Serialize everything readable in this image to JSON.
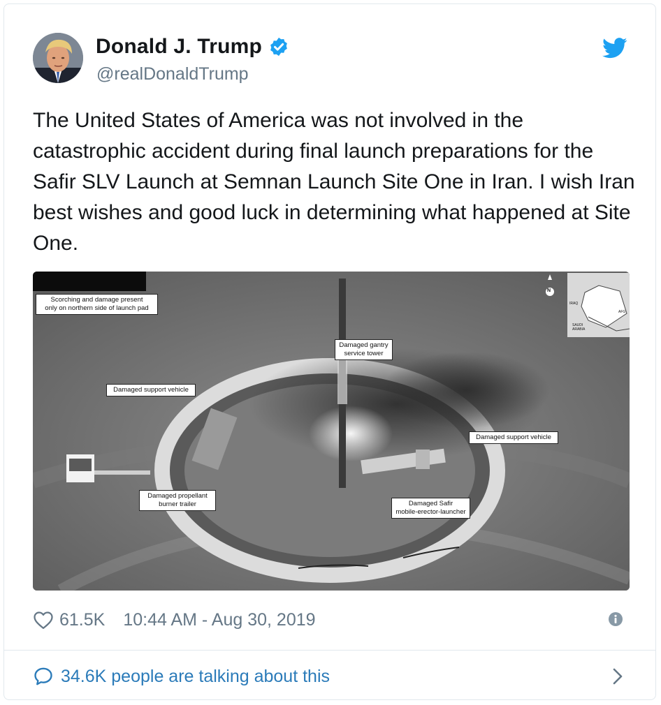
{
  "author": {
    "name": "Donald J. Trump",
    "handle": "@realDonaldTrump",
    "verified": true
  },
  "icons": {
    "verified": "verified-badge-icon",
    "brand": "twitter-bird-icon",
    "like": "heart-icon",
    "info": "info-icon",
    "reply": "speech-bubble-icon",
    "more": "chevron-right-icon"
  },
  "colors": {
    "brand": "#1da1f2",
    "link": "#2b7bb9",
    "muted": "#657786",
    "text": "#14171a"
  },
  "tweet": {
    "text": "The United States of America was not involved in the catastrophic accident during final launch preparations for the Safir SLV Launch at Semnan Launch Site One in Iran. I wish Iran best wishes and good luck in determining what happened at Site One."
  },
  "media": {
    "callouts": {
      "scorching": "Scorching and damage present\nonly on northern side of launch pad",
      "gantry": "Damaged gantry\nservice tower",
      "support_left": "Damaged support vehicle",
      "support_right": "Damaged support vehicle",
      "burner": "Damaged propellant\nburner trailer",
      "launcher": "Damaged Safir\nmobile-erector-launcher"
    },
    "map_labels": {
      "north": "N",
      "iraq": "IRAQ",
      "saudi": "SAUDI\nARABIA",
      "afg": "AFG"
    }
  },
  "footer": {
    "likes": "61.5K",
    "timestamp": "10:44 AM - Aug 30, 2019",
    "talking": "34.6K people are talking about this"
  }
}
